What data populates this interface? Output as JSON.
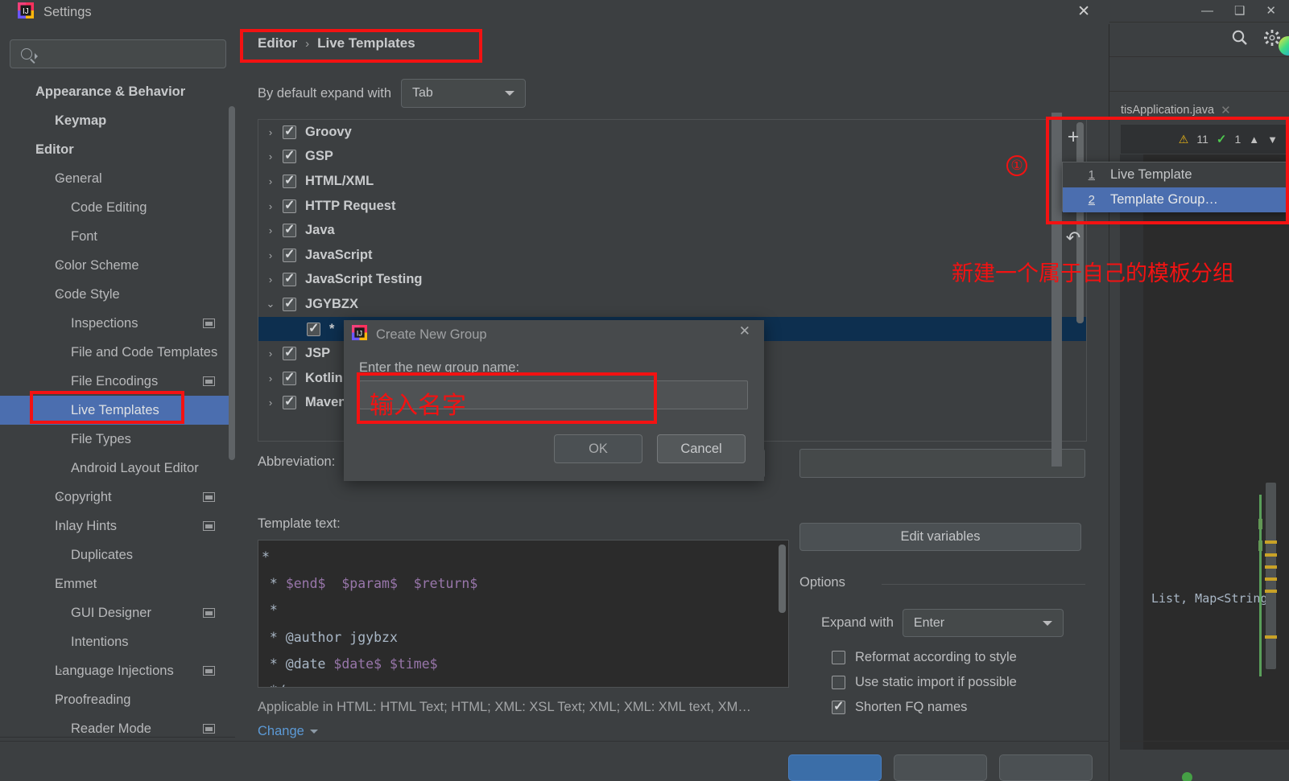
{
  "window": {
    "title": "Settings",
    "close_icon": "close-icon",
    "app_icon": "intellij-idea-logo"
  },
  "search": {
    "placeholder": "",
    "value": "",
    "icon": "search-icon"
  },
  "sidebar": {
    "items": [
      {
        "label": "Appearance & Behavior",
        "arrow": "›",
        "indent": 24,
        "bold": true,
        "badge": false,
        "selected": false
      },
      {
        "label": "Keymap",
        "arrow": "",
        "indent": 48,
        "bold": true,
        "badge": false,
        "selected": false
      },
      {
        "label": "Editor",
        "arrow": "⌄",
        "indent": 24,
        "bold": true,
        "badge": false,
        "selected": false
      },
      {
        "label": "General",
        "arrow": "›",
        "indent": 48,
        "bold": false,
        "badge": false,
        "selected": false
      },
      {
        "label": "Code Editing",
        "arrow": "",
        "indent": 68,
        "bold": false,
        "badge": false,
        "selected": false
      },
      {
        "label": "Font",
        "arrow": "",
        "indent": 68,
        "bold": false,
        "badge": false,
        "selected": false
      },
      {
        "label": "Color Scheme",
        "arrow": "›",
        "indent": 48,
        "bold": false,
        "badge": false,
        "selected": false
      },
      {
        "label": "Code Style",
        "arrow": "›",
        "indent": 48,
        "bold": false,
        "badge": false,
        "selected": false
      },
      {
        "label": "Inspections",
        "arrow": "",
        "indent": 68,
        "bold": false,
        "badge": true,
        "selected": false
      },
      {
        "label": "File and Code Templates",
        "arrow": "",
        "indent": 68,
        "bold": false,
        "badge": false,
        "selected": false
      },
      {
        "label": "File Encodings",
        "arrow": "",
        "indent": 68,
        "bold": false,
        "badge": true,
        "selected": false
      },
      {
        "label": "Live Templates",
        "arrow": "",
        "indent": 68,
        "bold": false,
        "badge": false,
        "selected": true
      },
      {
        "label": "File Types",
        "arrow": "",
        "indent": 68,
        "bold": false,
        "badge": false,
        "selected": false
      },
      {
        "label": "Android Layout Editor",
        "arrow": "",
        "indent": 68,
        "bold": false,
        "badge": false,
        "selected": false
      },
      {
        "label": "Copyright",
        "arrow": "›",
        "indent": 48,
        "bold": false,
        "badge": true,
        "selected": false
      },
      {
        "label": "Inlay Hints",
        "arrow": "›",
        "indent": 48,
        "bold": false,
        "badge": true,
        "selected": false
      },
      {
        "label": "Duplicates",
        "arrow": "",
        "indent": 68,
        "bold": false,
        "badge": false,
        "selected": false
      },
      {
        "label": "Emmet",
        "arrow": "›",
        "indent": 48,
        "bold": false,
        "badge": false,
        "selected": false
      },
      {
        "label": "GUI Designer",
        "arrow": "",
        "indent": 68,
        "bold": false,
        "badge": true,
        "selected": false
      },
      {
        "label": "Intentions",
        "arrow": "",
        "indent": 68,
        "bold": false,
        "badge": false,
        "selected": false
      },
      {
        "label": "Language Injections",
        "arrow": "›",
        "indent": 48,
        "bold": false,
        "badge": true,
        "selected": false
      },
      {
        "label": "Proofreading",
        "arrow": "›",
        "indent": 48,
        "bold": false,
        "badge": false,
        "selected": false
      },
      {
        "label": "Reader Mode",
        "arrow": "",
        "indent": 68,
        "bold": false,
        "badge": true,
        "selected": false
      }
    ]
  },
  "breadcrumb": {
    "parent": "Editor",
    "separator": "›",
    "current": "Live Templates"
  },
  "default_expand": {
    "label": "By default expand with",
    "value": "Tab"
  },
  "template_tree": {
    "rows": [
      {
        "label": "Groovy",
        "arrow": "›",
        "checked": true,
        "child": false,
        "selected": false
      },
      {
        "label": "GSP",
        "arrow": "›",
        "checked": true,
        "child": false,
        "selected": false
      },
      {
        "label": "HTML/XML",
        "arrow": "›",
        "checked": true,
        "child": false,
        "selected": false
      },
      {
        "label": "HTTP Request",
        "arrow": "›",
        "checked": true,
        "child": false,
        "selected": false
      },
      {
        "label": "Java",
        "arrow": "›",
        "checked": true,
        "child": false,
        "selected": false
      },
      {
        "label": "JavaScript",
        "arrow": "›",
        "checked": true,
        "child": false,
        "selected": false
      },
      {
        "label": "JavaScript Testing",
        "arrow": "›",
        "checked": true,
        "child": false,
        "selected": false
      },
      {
        "label": "JGYBZX",
        "arrow": "⌄",
        "checked": true,
        "child": false,
        "selected": false
      },
      {
        "label": "*",
        "arrow": "",
        "checked": true,
        "child": true,
        "selected": true
      },
      {
        "label": "JSP",
        "arrow": "›",
        "checked": true,
        "child": false,
        "selected": false
      },
      {
        "label": "Kotlin",
        "arrow": "›",
        "checked": true,
        "child": false,
        "selected": false
      },
      {
        "label": "Maven",
        "arrow": "›",
        "checked": true,
        "child": false,
        "selected": false
      }
    ]
  },
  "abbreviation": {
    "label": "Abbreviation:",
    "value": "",
    "description_value": ""
  },
  "template_text": {
    "label": "Template text:",
    "lines": [
      [
        {
          "t": "*",
          "v": false
        }
      ],
      [
        {
          "t": " * ",
          "v": false
        },
        {
          "t": "$end$",
          "v": true
        },
        {
          "t": "  ",
          "v": false
        },
        {
          "t": "$param$",
          "v": true
        },
        {
          "t": "  ",
          "v": false
        },
        {
          "t": "$return$",
          "v": true
        }
      ],
      [
        {
          "t": " *",
          "v": false
        }
      ],
      [
        {
          "t": " * @author jgybzx",
          "v": false
        }
      ],
      [
        {
          "t": " * @date ",
          "v": false
        },
        {
          "t": "$date$",
          "v": true
        },
        {
          "t": " ",
          "v": false
        },
        {
          "t": "$time$",
          "v": true
        }
      ],
      [
        {
          "t": " */",
          "v": false
        }
      ]
    ],
    "applicable": "Applicable in HTML: HTML Text; HTML; XML: XSL Text; XML; XML: XML text, XM…",
    "change_link": "Change"
  },
  "options": {
    "edit_variables_label": "Edit variables",
    "group_title": "Options",
    "expand_with_label": "Expand with",
    "expand_with_value": "Enter",
    "checkboxes": [
      {
        "label": "Reformat according to style",
        "checked": false
      },
      {
        "label": "Use static import if possible",
        "checked": false
      },
      {
        "label": "Shorten FQ names",
        "checked": true
      }
    ]
  },
  "modal": {
    "title": "Create New Group",
    "prompt": "Enter the new group name:",
    "input_value": "",
    "ok_label": "OK",
    "cancel_label": "Cancel",
    "close_icon": "close-icon"
  },
  "add_popup": {
    "plus_icon": "plus-icon",
    "undo_icon": "undo-arrow-icon",
    "items": [
      {
        "num": "1",
        "label": "Live Template",
        "highlighted": false
      },
      {
        "num": "2",
        "label": "Template Group…",
        "highlighted": true
      }
    ]
  },
  "ide": {
    "tab_label": "tisApplication.java",
    "tab_close_icon": "close-icon",
    "search_icon": "search-icon",
    "gear_icon": "gear-icon",
    "minimize_icon": "minimize-icon",
    "restore_icon": "restore-icon",
    "close_icon": "close-icon",
    "warning_count": "11",
    "ok_count": "1",
    "up_icon": "chevron-up-icon",
    "down_icon": "chevron-down-icon",
    "code_fragment": "List, Map<String"
  },
  "annotations": {
    "marker_one": "①",
    "note_cn": "新建一个属于自己的模板分组",
    "input_hint_cn": "输入名字",
    "accent": "#f31212"
  }
}
